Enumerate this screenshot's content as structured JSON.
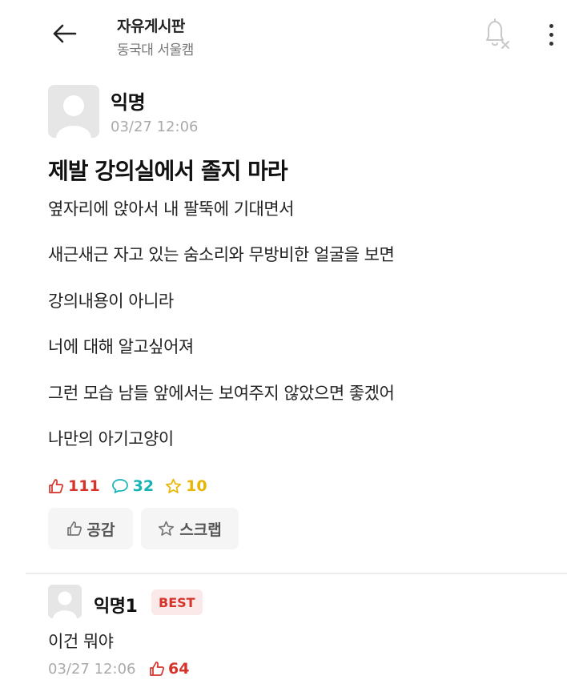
{
  "header": {
    "board_title": "자유게시판",
    "board_subtitle": "동국대 서울캠",
    "back_icon": "arrow-left-icon",
    "bell_icon": "bell-off-icon",
    "more_icon": "more-vertical-icon"
  },
  "post": {
    "author": "익명",
    "date": "03/27 12:06",
    "title": "제발 강의실에서 졸지 마라",
    "lines": [
      "옆자리에 앉아서 내 팔뚝에 기대면서",
      "새근새근 자고 있는 숨소리와 무방비한 얼굴을 보면",
      "강의내용이 아니라",
      "너에 대해 알고싶어져",
      "그런 모습 남들 앞에서는 보여주지 않았으면 좋겠어",
      "나만의 아기고양이"
    ],
    "stats": {
      "likes": "111",
      "comments": "32",
      "scraps": "10"
    },
    "actions": {
      "like_label": "공감",
      "scrap_label": "스크랩"
    }
  },
  "comment": {
    "author": "익명1",
    "badge": "BEST",
    "text": "이건 뭐야",
    "date": "03/27 12:06",
    "likes": "64"
  },
  "colors": {
    "like": "#d6332b",
    "comment": "#14b3b8",
    "scrap": "#e8b500",
    "muted": "#aaaaaa"
  }
}
